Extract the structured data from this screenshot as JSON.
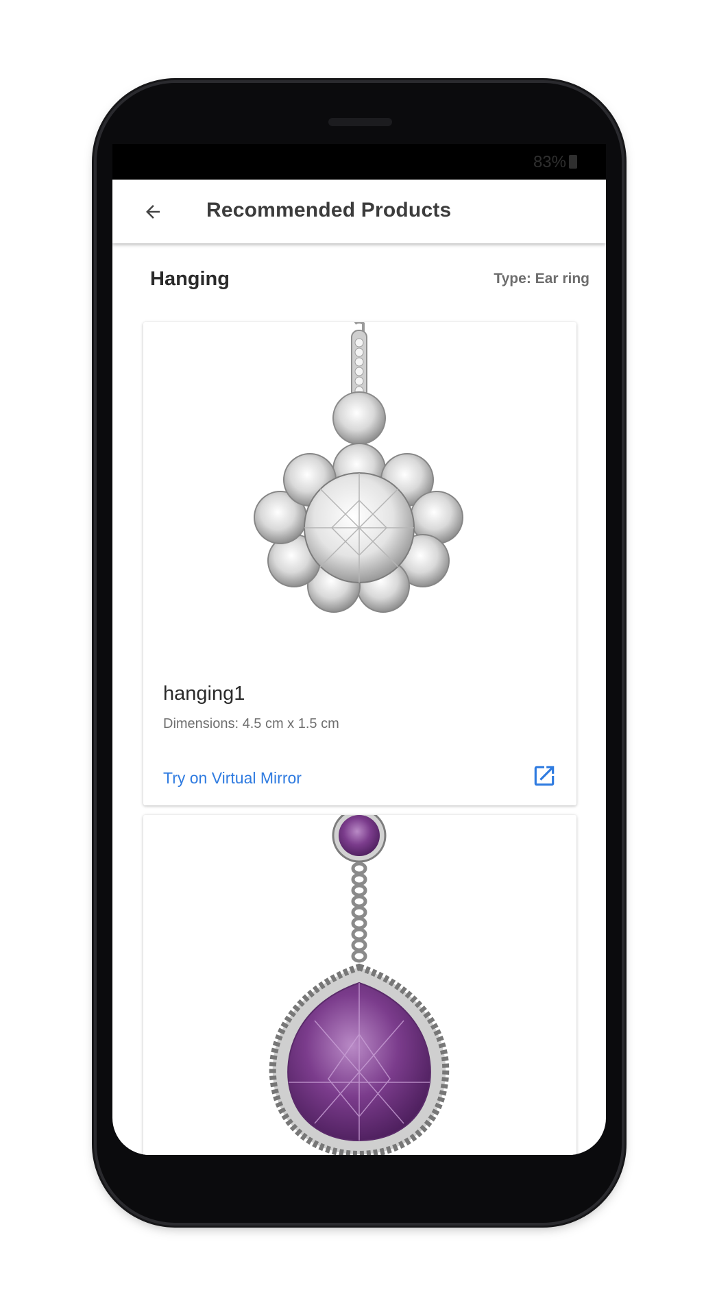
{
  "status_bar": {
    "battery": "83%"
  },
  "appbar": {
    "title": "Recommended Products",
    "back_icon": "arrow-back-icon"
  },
  "section": {
    "title": "Hanging",
    "type_label": "Type: Ear ring"
  },
  "products": [
    {
      "name": "hanging1",
      "dimensions": "Dimensions: 4.5 cm x 1.5 cm",
      "action_label": "Try on Virtual Mirror",
      "action_icon": "open-in-new-icon"
    }
  ],
  "colors": {
    "accent": "#2f7be0",
    "amethyst": "#7b3c8c"
  }
}
